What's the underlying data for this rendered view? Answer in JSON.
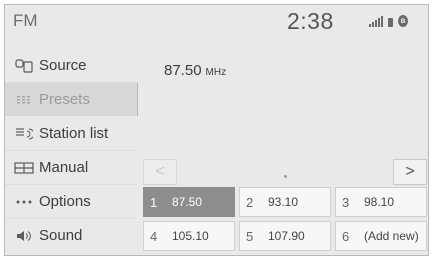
{
  "header": {
    "title": "FM",
    "time": "2:38",
    "status_icons": [
      "signal-icon",
      "battery-icon",
      "bluetooth-icon"
    ]
  },
  "sidebar": {
    "items": [
      {
        "label": "Source",
        "icon": "source-icon",
        "selected": false
      },
      {
        "label": "Presets",
        "icon": "presets-icon",
        "selected": true
      },
      {
        "label": "Station list",
        "icon": "station-list-icon",
        "selected": false
      },
      {
        "label": "Manual",
        "icon": "manual-icon",
        "selected": false
      },
      {
        "label": "Options",
        "icon": "options-icon",
        "selected": false
      },
      {
        "label": "Sound",
        "icon": "sound-icon",
        "selected": false
      }
    ]
  },
  "tuner": {
    "frequency": "87.50",
    "unit": "MHz"
  },
  "pager": {
    "prev": "<",
    "next": ">"
  },
  "presets": [
    {
      "num": "1",
      "value": "87.50",
      "active": true
    },
    {
      "num": "2",
      "value": "93.10",
      "active": false
    },
    {
      "num": "3",
      "value": "98.10",
      "active": false
    },
    {
      "num": "4",
      "value": "105.10",
      "active": false
    },
    {
      "num": "5",
      "value": "107.90",
      "active": false
    },
    {
      "num": "6",
      "value": "(Add new)",
      "active": false
    }
  ],
  "colors": {
    "background": "#e9e9e9",
    "active_preset": "#8d8d8d",
    "preset_bg": "#f7f7f7"
  }
}
